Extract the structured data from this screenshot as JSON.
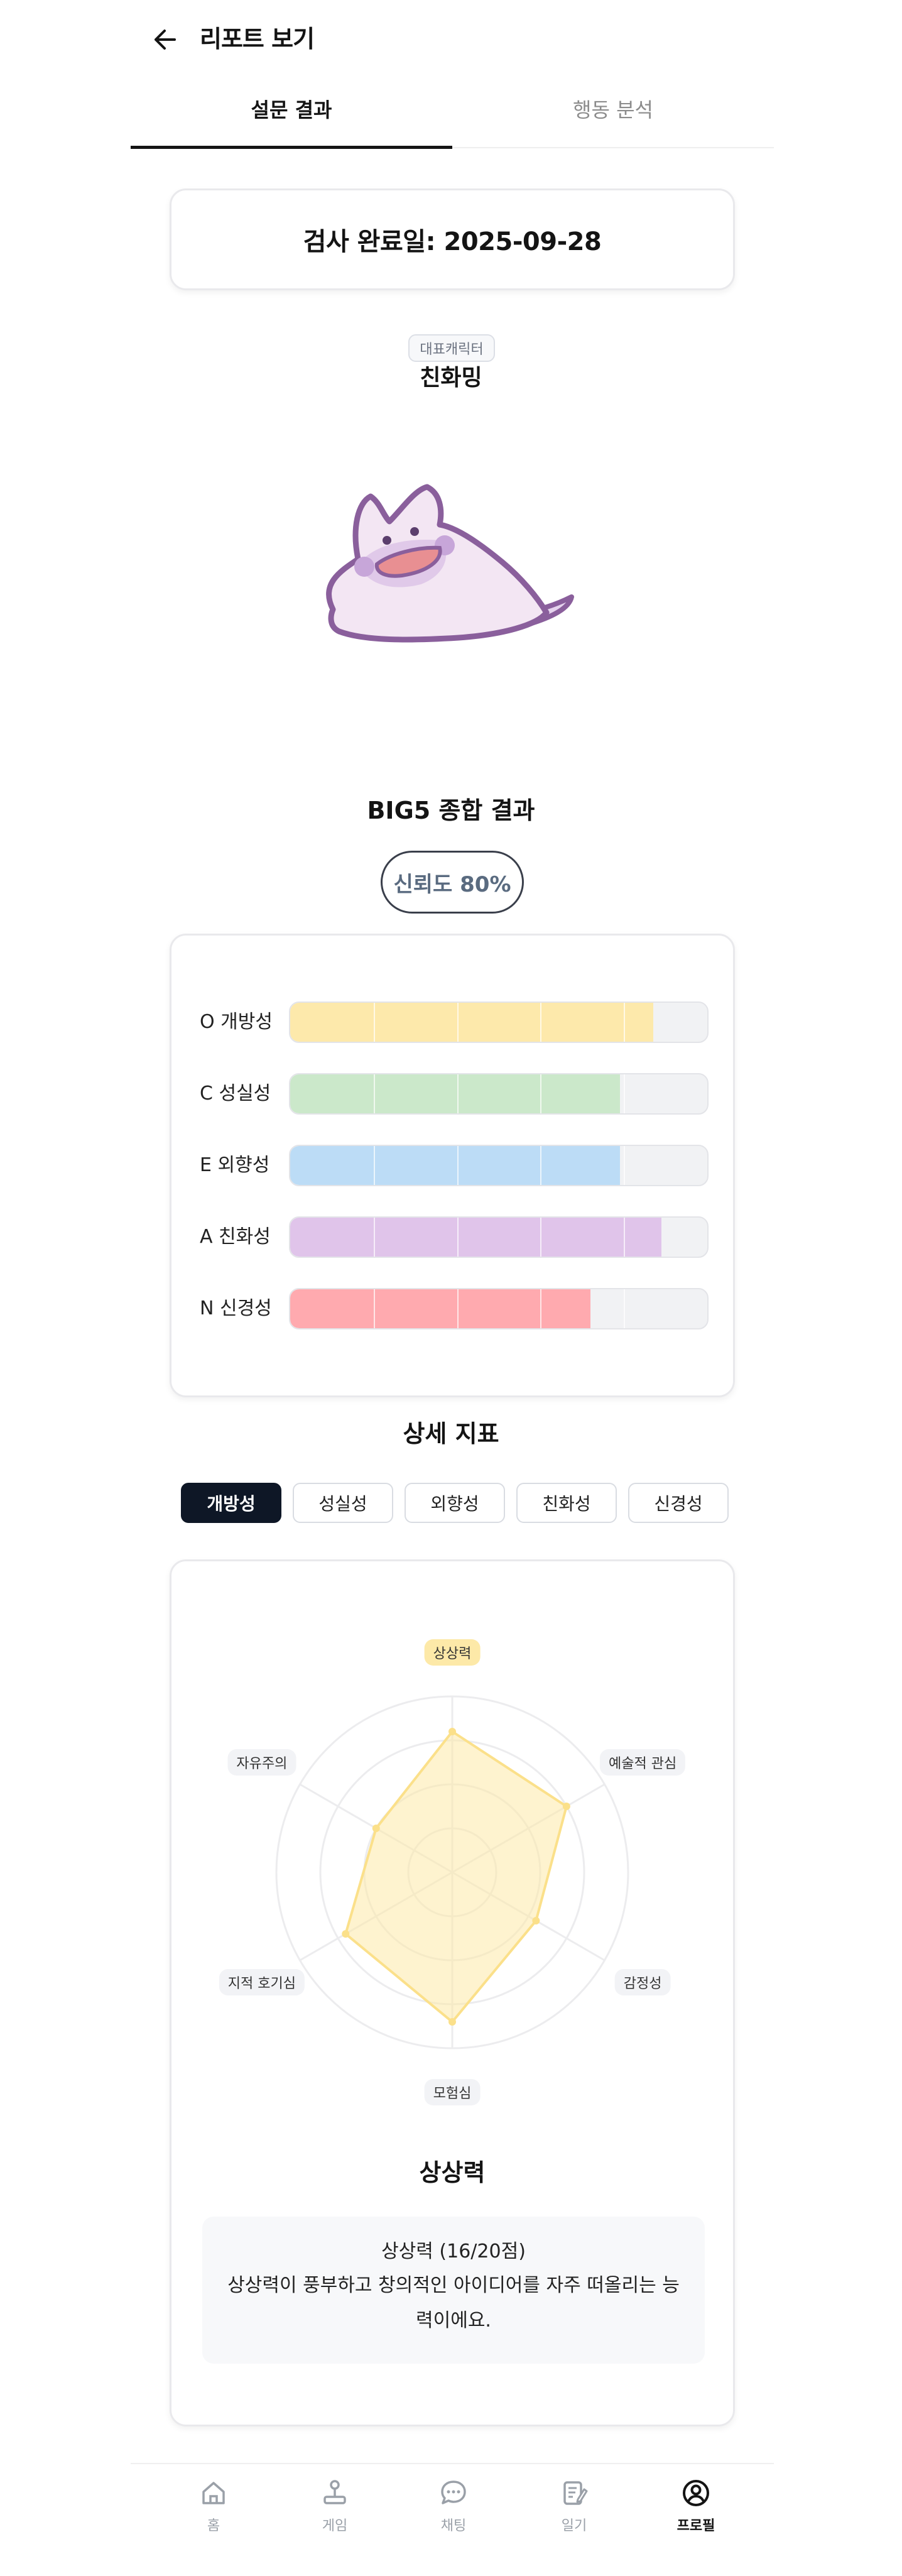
{
  "header": {
    "title": "리포트 보기"
  },
  "tabs": [
    {
      "label": "설문 결과",
      "active": true
    },
    {
      "label": "행동 분석",
      "active": false
    }
  ],
  "completion": {
    "label": "검사 완료일: 2025-09-28"
  },
  "character": {
    "badge": "대표캐릭터",
    "name": "친화밍"
  },
  "big5": {
    "title": "BIG5 종합 결과",
    "reliability": "신뢰도 80%"
  },
  "chart_data": [
    {
      "type": "bar",
      "orientation": "horizontal",
      "categories": [
        "O 개방성",
        "C 성실성",
        "E 외향성",
        "A 친화성",
        "N 신경성"
      ],
      "values": [
        0.87,
        0.79,
        0.79,
        0.89,
        0.72
      ],
      "colors": [
        "#fde9ab",
        "#cbe8ca",
        "#bcdcf6",
        "#e0c4ea",
        "#ffaaaf"
      ],
      "xlim": [
        0,
        1
      ]
    },
    {
      "type": "radar",
      "axes": [
        "상상력",
        "예술적 관심",
        "감정성",
        "모험심",
        "지적 호기심",
        "자유주의"
      ],
      "values": [
        16,
        15,
        11,
        17,
        14,
        10
      ],
      "max": 20,
      "color": "#fde9a8",
      "highlighted": "상상력"
    }
  ],
  "detail": {
    "title": "상세 지표",
    "chips": [
      "개방성",
      "성실성",
      "외향성",
      "친화성",
      "신경성"
    ],
    "selected_index": 0,
    "selected_title": "상상력",
    "desc_head": "상상력 (16/20점)",
    "desc_body": "상상력이 풍부하고 창의적인 아이디어를 자주 떠올리는 능력이에요."
  },
  "nav": [
    {
      "label": "홈",
      "icon": "home-icon"
    },
    {
      "label": "게임",
      "icon": "joystick-icon"
    },
    {
      "label": "채팅",
      "icon": "chat-icon"
    },
    {
      "label": "일기",
      "icon": "diary-icon"
    },
    {
      "label": "프로필",
      "icon": "profile-icon",
      "active": true
    }
  ]
}
